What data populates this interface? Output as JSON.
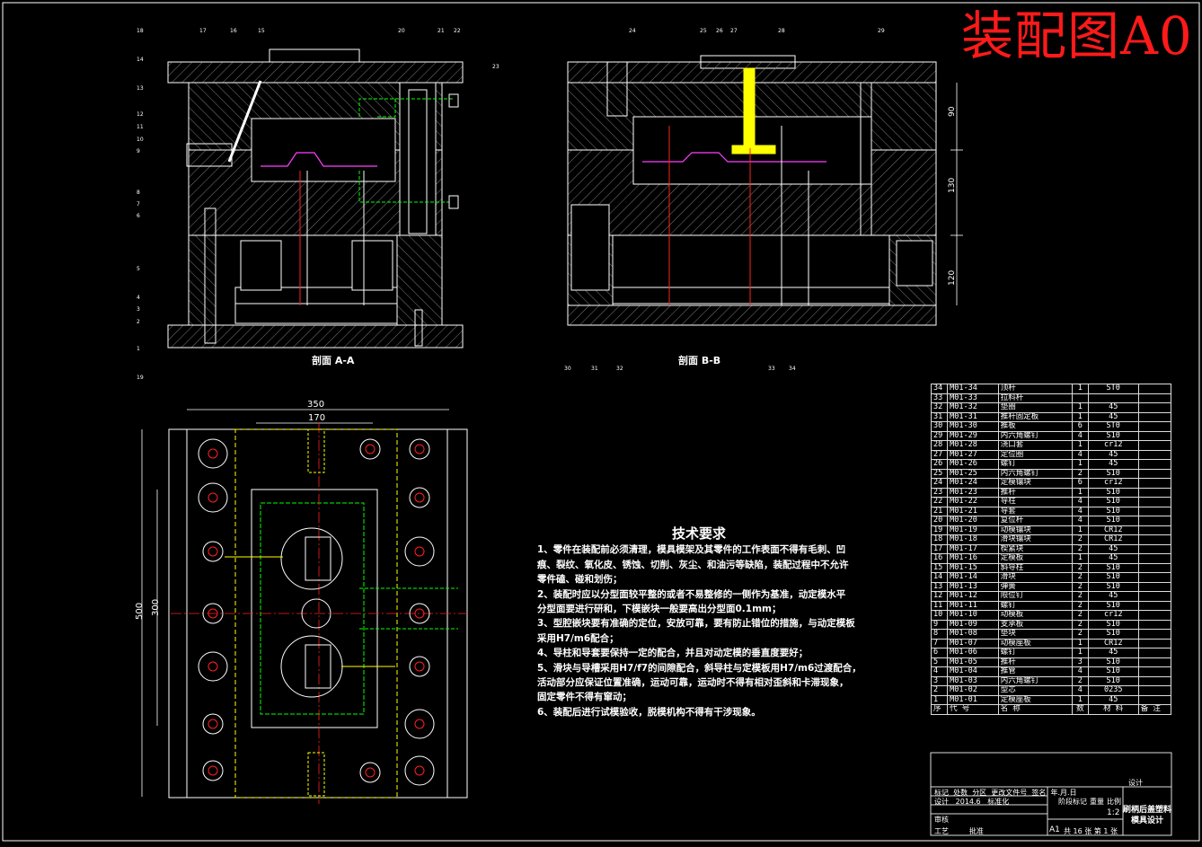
{
  "title": "装配图A0",
  "section_labels": {
    "a": "剖面 A-A",
    "b": "剖面 B-B"
  },
  "dimensions": {
    "w350": "350",
    "w170": "170",
    "h500": "500",
    "h300": "300",
    "d90": "90",
    "d130": "130",
    "d120": "120"
  },
  "leaders_a": [
    "18",
    "17",
    "16",
    "15",
    "14",
    "13",
    "12",
    "11",
    "10",
    "9",
    "8",
    "7",
    "6",
    "5",
    "4",
    "3",
    "2",
    "1",
    "19",
    "20",
    "21",
    "22",
    "23"
  ],
  "leaders_b": [
    "24",
    "25",
    "26",
    "27",
    "28",
    "29",
    "30",
    "31",
    "32",
    "33",
    "34"
  ],
  "tech_requirements": {
    "heading": "技术要求",
    "lines": [
      "1、零件在装配前必须清理，模具模架及其零件的工作表面不得有毛刺、凹",
      "痕、裂纹、氧化皮、锈蚀、切削、灰尘、和油污等缺陷，装配过程中不允许",
      "零件磕、碰和划伤；",
      "2、装配时应以分型面较平整的或者不易整修的一侧作为基准，动定模水平",
      "分型面要进行研和，下模嵌块一般要高出分型面0.1mm；",
      "3、型腔嵌块要有准确的定位，安放可靠，要有防止错位的措施，与动定模板",
      "采用H7/m6配合；",
      "4、导柱和导套要保持一定的配合，并且对动定模的垂直度要好；",
      "5、滑块与导槽采用H7/f7的间隙配合，斜导柱与定模板用H7/m6过渡配合，",
      "活动部分应保证位置准确，运动可靠，运动时不得有相对歪斜和卡滞现象，",
      "固定零件不得有窜动；",
      "6、装配后进行试模验收，脱模机构不得有干涉现象。"
    ]
  },
  "bom_rows": [
    {
      "no": "34",
      "code": "M01-34",
      "name": "顶杆",
      "qty": "1",
      "mat": "ST0"
    },
    {
      "no": "33",
      "code": "M01-33",
      "name": "拉料杆",
      "qty": "",
      "mat": ""
    },
    {
      "no": "32",
      "code": "M01-32",
      "name": "垫圈",
      "qty": "1",
      "mat": "45"
    },
    {
      "no": "31",
      "code": "M01-31",
      "name": "推杆固定板",
      "qty": "1",
      "mat": "45"
    },
    {
      "no": "30",
      "code": "M01-30",
      "name": "推板",
      "qty": "6",
      "mat": "ST0"
    },
    {
      "no": "29",
      "code": "M01-29",
      "name": "内六角螺钉",
      "qty": "4",
      "mat": "S10"
    },
    {
      "no": "28",
      "code": "M01-28",
      "name": "浇口套",
      "qty": "1",
      "mat": "cr12"
    },
    {
      "no": "27",
      "code": "M01-27",
      "name": "定位圈",
      "qty": "4",
      "mat": "45"
    },
    {
      "no": "26",
      "code": "M01-26",
      "name": "螺钉",
      "qty": "1",
      "mat": "45"
    },
    {
      "no": "25",
      "code": "M01-25",
      "name": "内六角螺钉",
      "qty": "2",
      "mat": "S10"
    },
    {
      "no": "24",
      "code": "M01-24",
      "name": "定模镶块",
      "qty": "6",
      "mat": "cr12"
    },
    {
      "no": "23",
      "code": "M01-23",
      "name": "推杆",
      "qty": "1",
      "mat": "S10"
    },
    {
      "no": "22",
      "code": "M01-22",
      "name": "导柱",
      "qty": "4",
      "mat": "S10"
    },
    {
      "no": "21",
      "code": "M01-21",
      "name": "导套",
      "qty": "4",
      "mat": "S10"
    },
    {
      "no": "20",
      "code": "M01-20",
      "name": "复位杆",
      "qty": "4",
      "mat": "S10"
    },
    {
      "no": "19",
      "code": "M01-19",
      "name": "动模镶块",
      "qty": "1",
      "mat": "CR12"
    },
    {
      "no": "18",
      "code": "M01-18",
      "name": "滑块镶块",
      "qty": "2",
      "mat": "CR12"
    },
    {
      "no": "17",
      "code": "M01-17",
      "name": "楔紧块",
      "qty": "2",
      "mat": "45"
    },
    {
      "no": "16",
      "code": "M01-16",
      "name": "定模板",
      "qty": "1",
      "mat": "45"
    },
    {
      "no": "15",
      "code": "M01-15",
      "name": "斜导柱",
      "qty": "2",
      "mat": "S10"
    },
    {
      "no": "14",
      "code": "M01-14",
      "name": "滑块",
      "qty": "2",
      "mat": "S10"
    },
    {
      "no": "13",
      "code": "M01-13",
      "name": "弹簧",
      "qty": "2",
      "mat": "S10"
    },
    {
      "no": "12",
      "code": "M01-12",
      "name": "限位钉",
      "qty": "2",
      "mat": "45"
    },
    {
      "no": "11",
      "code": "M01-11",
      "name": "螺钉",
      "qty": "2",
      "mat": "S10"
    },
    {
      "no": "10",
      "code": "M01-10",
      "name": "动模板",
      "qty": "2",
      "mat": "cr12"
    },
    {
      "no": "9",
      "code": "M01-09",
      "name": "支承板",
      "qty": "2",
      "mat": "S10"
    },
    {
      "no": "8",
      "code": "M01-08",
      "name": "垫块",
      "qty": "2",
      "mat": "S10"
    },
    {
      "no": "7",
      "code": "M01-07",
      "name": "动模座板",
      "qty": "1",
      "mat": "CR12"
    },
    {
      "no": "6",
      "code": "M01-06",
      "name": "螺钉",
      "qty": "1",
      "mat": "45"
    },
    {
      "no": "5",
      "code": "M01-05",
      "name": "推杆",
      "qty": "3",
      "mat": "S10"
    },
    {
      "no": "4",
      "code": "M01-04",
      "name": "推管",
      "qty": "4",
      "mat": "S10"
    },
    {
      "no": "3",
      "code": "M01-03",
      "name": "内六角螺钉",
      "qty": "2",
      "mat": "S10"
    },
    {
      "no": "2",
      "code": "M01-02",
      "name": "型芯",
      "qty": "4",
      "mat": "0235"
    },
    {
      "no": "1",
      "code": "M01-01",
      "name": "定模座板",
      "qty": "1",
      "mat": "45"
    }
  ],
  "bom_header": {
    "no": "序",
    "code": "代  号",
    "name": "名  称",
    "qty": "数",
    "mat": "材  料",
    "note": "备 注"
  },
  "title_block": {
    "row1": [
      "标记",
      "处数",
      "分区",
      "更改文件号",
      "签名",
      "年.月.日"
    ],
    "row2": [
      "设计",
      "2014.6",
      "标准化"
    ],
    "row3": [
      "审核"
    ],
    "row4": [
      "工艺",
      "批准"
    ],
    "stage": "阶段标记",
    "weight": "重量",
    "ratio_label": "比例",
    "ratio": "1:2",
    "sheet": "共 16 张  第 1 张",
    "paper": "A1",
    "drawing_title": "刷柄后盖塑料模具设计",
    "design_label": "设计"
  },
  "colors": {
    "title": "#ff1a1a",
    "line": "#ffffff",
    "green": "#00ff00",
    "red": "#ff2020",
    "yellow": "#ffff00",
    "cyan": "#00e5ff",
    "magenta": "#ff40ff"
  }
}
